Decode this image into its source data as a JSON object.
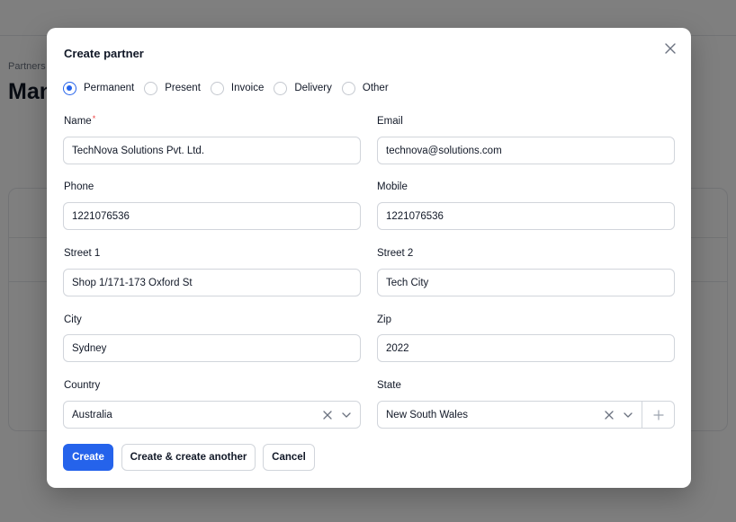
{
  "background": {
    "breadcrumb": "Partners",
    "title": "Man"
  },
  "modal": {
    "title": "Create partner",
    "address_types": [
      {
        "label": "Permanent",
        "checked": true
      },
      {
        "label": "Present",
        "checked": false
      },
      {
        "label": "Invoice",
        "checked": false
      },
      {
        "label": "Delivery",
        "checked": false
      },
      {
        "label": "Other",
        "checked": false
      }
    ],
    "fields": {
      "name": {
        "label": "Name",
        "required_mark": "*",
        "value": "TechNova Solutions Pvt. Ltd."
      },
      "email": {
        "label": "Email",
        "value": "technova@solutions.com"
      },
      "phone": {
        "label": "Phone",
        "value": "1221076536"
      },
      "mobile": {
        "label": "Mobile",
        "value": "1221076536"
      },
      "street1": {
        "label": "Street 1",
        "value": "Shop 1/171-173 Oxford St"
      },
      "street2": {
        "label": "Street 2",
        "value": "Tech City"
      },
      "city": {
        "label": "City",
        "value": "Sydney"
      },
      "zip": {
        "label": "Zip",
        "value": "2022"
      },
      "country": {
        "label": "Country",
        "value": "Australia"
      },
      "state": {
        "label": "State",
        "value": "New South Wales"
      }
    },
    "buttons": {
      "create": "Create",
      "create_another": "Create & create another",
      "cancel": "Cancel"
    }
  },
  "colors": {
    "accent": "#2563eb",
    "required": "#ef4444",
    "border": "#d1d5db",
    "overlay": "rgba(0,0,0,0.5)"
  },
  "icons": {
    "close": "close-icon",
    "clear": "clear-x-icon",
    "dropdown": "chevron-down-icon",
    "add": "plus-icon"
  }
}
